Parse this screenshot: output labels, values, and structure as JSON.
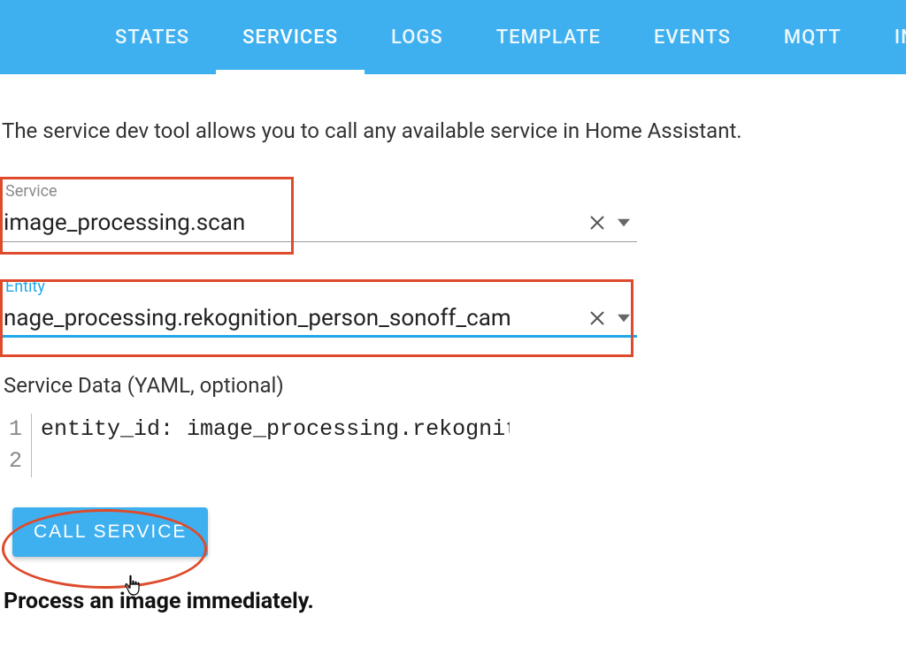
{
  "tabs": [
    {
      "label": "STATES"
    },
    {
      "label": "SERVICES"
    },
    {
      "label": "LOGS"
    },
    {
      "label": "TEMPLATE"
    },
    {
      "label": "EVENTS"
    },
    {
      "label": "MQTT"
    },
    {
      "label": "INFO"
    }
  ],
  "active_tab_index": 1,
  "intro": "The service dev tool allows you to call any available service in Home Assistant.",
  "service": {
    "label": "Service",
    "value": "image_processing.scan"
  },
  "entity": {
    "label": "Entity",
    "value": "nage_processing.rekognition_person_sonoff_cam"
  },
  "service_data": {
    "label": "Service Data (YAML, optional)",
    "lines": [
      "entity_id: image_processing.rekognition_pers",
      ""
    ]
  },
  "call_button": "CALL SERVICE",
  "description": "Process an image immediately."
}
